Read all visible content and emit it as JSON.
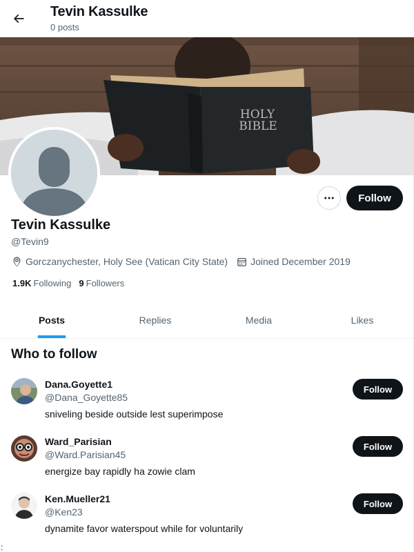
{
  "header": {
    "title": "Tevin Kassulke",
    "subtitle": "0 posts"
  },
  "banner": {
    "book_title_line1": "HOLY",
    "book_title_line2": "BIBLE"
  },
  "profile": {
    "name": "Tevin Kassulke",
    "handle": "@Tevin9",
    "location": "Gorczanychester, Holy See (Vatican City State)",
    "joined": "Joined December 2019",
    "following_count": "1.9K",
    "following_label": "Following",
    "followers_count": "9",
    "followers_label": "Followers",
    "follow_label": "Follow"
  },
  "tabs": [
    {
      "label": "Posts",
      "active": true
    },
    {
      "label": "Replies",
      "active": false
    },
    {
      "label": "Media",
      "active": false
    },
    {
      "label": "Likes",
      "active": false
    }
  ],
  "who_to_follow": {
    "title": "Who to follow",
    "items": [
      {
        "name": "Dana.Goyette1",
        "handle": "@Dana_Goyette85",
        "bio": "sniveling beside outside lest superimpose",
        "follow_label": "Follow"
      },
      {
        "name": "Ward_Parisian",
        "handle": "@Ward.Parisian45",
        "bio": "energize bay rapidly ha zowie clam",
        "follow_label": "Follow"
      },
      {
        "name": "Ken.Mueller21",
        "handle": "@Ken23",
        "bio": "dynamite favor waterspout while for voluntarily",
        "follow_label": "Follow"
      }
    ]
  },
  "stray_text": ":",
  "colors": {
    "accent": "#1d9bf0",
    "button_dark": "#0f1419",
    "secondary_text": "#536471",
    "avatar_placeholder": "#cfd9de"
  },
  "icons": [
    "arrow-left-icon",
    "more-icon",
    "location-icon",
    "calendar-icon"
  ]
}
